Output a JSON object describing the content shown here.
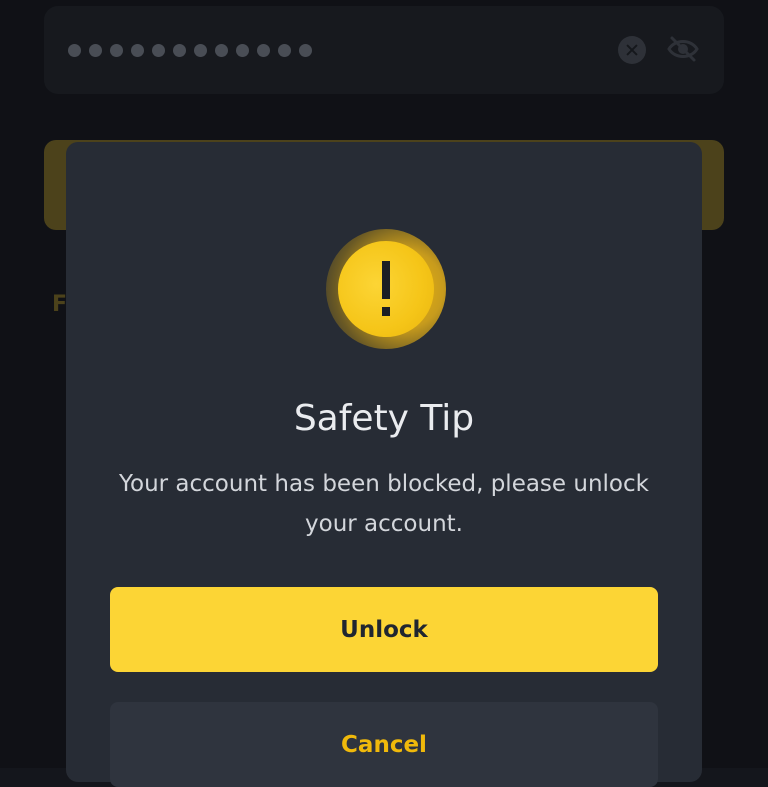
{
  "background": {
    "password_field": {
      "masked_value": "••••••••••••",
      "icons": [
        "clear-icon",
        "eye-slash-icon"
      ]
    },
    "partial_letter": "F"
  },
  "dialog": {
    "icon": "warning-icon",
    "title": "Safety Tip",
    "message": "Your account has been blocked, please unlock your account.",
    "primary_button": "Unlock",
    "secondary_button": "Cancel"
  },
  "colors": {
    "accent_yellow": "#fcd535",
    "cancel_text": "#f0b90b",
    "dialog_bg": "#272c35",
    "page_bg": "#14161c"
  }
}
